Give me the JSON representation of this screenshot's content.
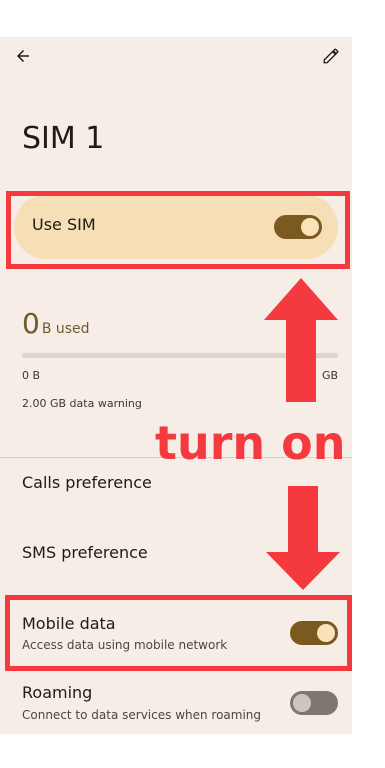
{
  "screen": {
    "title": "SIM 1"
  },
  "use_sim": {
    "label": "Use SIM",
    "state": "on"
  },
  "usage": {
    "amount": "0",
    "unit": "B used",
    "range_start": "0 B",
    "range_end": "GB",
    "warning": "2.00 GB data warning",
    "progress_fraction": 0
  },
  "rows": {
    "calls": {
      "title": "Calls preference"
    },
    "sms": {
      "title": "SMS preference"
    },
    "mobile_data": {
      "title": "Mobile data",
      "subtitle": "Access data using mobile network",
      "state": "on"
    },
    "roaming": {
      "title": "Roaming",
      "subtitle": "Connect to data services when roaming",
      "state": "off"
    }
  },
  "annotation": {
    "text": "turn on",
    "color": "#f4393f"
  },
  "colors": {
    "background": "#f6ede6",
    "accent": "#7a5a1e",
    "card": "#f6deb6"
  },
  "icons": {
    "back": "back-arrow-icon",
    "edit": "pencil-icon"
  }
}
